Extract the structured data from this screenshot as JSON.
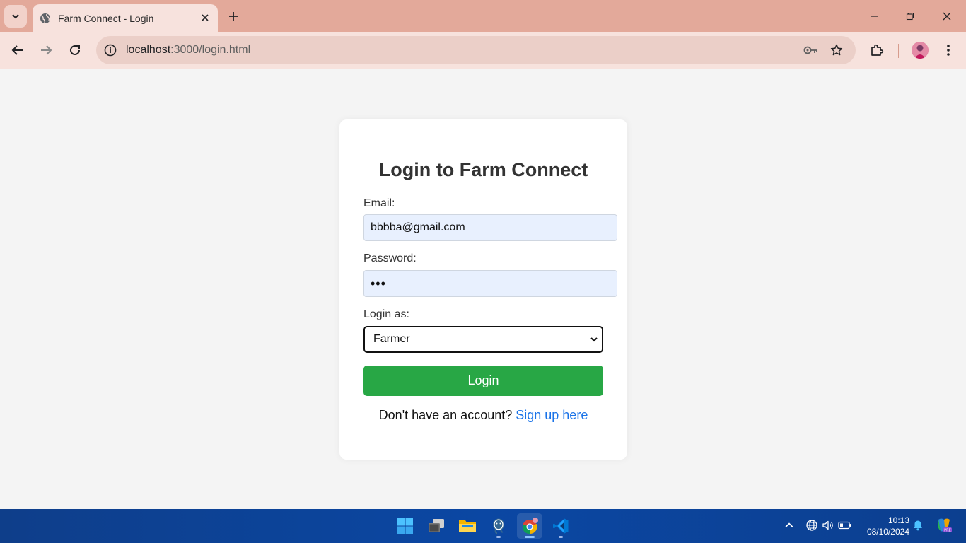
{
  "browser": {
    "tab_title": "Farm Connect - Login",
    "url_host": "localhost",
    "url_path": ":3000/login.html"
  },
  "page": {
    "heading": "Login to Farm Connect",
    "email_label": "Email:",
    "email_value": "bbbba@gmail.com",
    "password_label": "Password:",
    "password_value": "•••",
    "role_label": "Login as:",
    "role_selected": "Farmer",
    "login_button": "Login",
    "signup_prompt": "Don't have an account? ",
    "signup_link": "Sign up here"
  },
  "taskbar": {
    "time": "10:13",
    "date": "08/10/2024",
    "apps": [
      "start-icon",
      "task-view-icon",
      "file-explorer-icon",
      "postgresql-icon",
      "chrome-icon",
      "vscode-icon"
    ]
  },
  "colors": {
    "accent_green": "#28a745",
    "link_blue": "#1a73e8",
    "tabstrip": "#e3a99a",
    "toolbar": "#f7e2dd"
  }
}
